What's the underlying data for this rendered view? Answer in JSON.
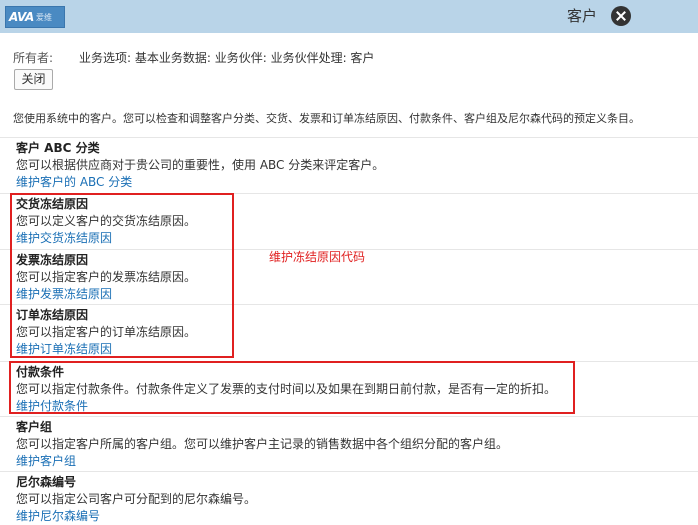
{
  "header": {
    "logo_text": "AVA",
    "logo_subtext": "爱维",
    "title": "客户",
    "close_icon": "close-icon"
  },
  "owner": {
    "label": "所有者:",
    "value": "业务选项: 基本业务数据: 业务伙伴: 业务伙伴处理: 客户"
  },
  "close_button_label": "关闭",
  "intro": "您使用系统中的客户。您可以检查和调整客户分类、交货、发票和订单冻结原因、付款条件、客户组及尼尔森代码的预定义条目。",
  "sections": [
    {
      "title": "客户 ABC 分类",
      "description": "您可以根据供应商对于贵公司的重要性，使用 ABC 分类来评定客户。",
      "link": "维护客户的 ABC 分类"
    },
    {
      "title": "交货冻结原因",
      "description": "您可以定义客户的交货冻结原因。",
      "link": "维护交货冻结原因"
    },
    {
      "title": "发票冻结原因",
      "description": "您可以指定客户的发票冻结原因。",
      "link": "维护发票冻结原因"
    },
    {
      "title": "订单冻结原因",
      "description": "您可以指定客户的订单冻结原因。",
      "link": "维护订单冻结原因"
    },
    {
      "title": "付款条件",
      "description": "您可以指定付款条件。付款条件定义了发票的支付时间以及如果在到期日前付款，是否有一定的折扣。",
      "link": "维护付款条件"
    },
    {
      "title": "客户组",
      "description": "您可以指定客户所属的客户组。您可以维护客户主记录的销售数据中各个组织分配的客户组。",
      "link": "维护客户组"
    },
    {
      "title": "尼尔森编号",
      "description": "您可以指定公司客户可分配到的尼尔森编号。",
      "link": "维护尼尔森编号"
    }
  ],
  "annotation": "维护冻结原因代码",
  "colors": {
    "header_bg": "#b9d4e8",
    "link": "#1a6fb5",
    "highlight": "#e02020"
  }
}
